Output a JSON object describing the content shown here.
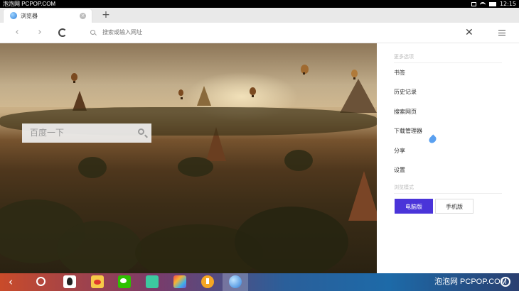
{
  "status_bar": {
    "watermark": "泡泡网 PCPOP.COM",
    "time": "12:15"
  },
  "tab": {
    "title": "浏览器",
    "close_glyph": "×",
    "new_tab_glyph": "+"
  },
  "toolbar": {
    "back_glyph": "‹",
    "forward_glyph": "›",
    "url_placeholder": "搜索或输入网址",
    "close_glyph": "✕"
  },
  "page": {
    "search_placeholder": "百度一下"
  },
  "menu": {
    "section_title": "更多选项",
    "items": [
      "书签",
      "历史记录",
      "搜索网页",
      "下载管理器",
      "分享",
      "设置"
    ],
    "mode_title": "浏览模式",
    "mode_desktop": "电脑版",
    "mode_mobile": "手机版",
    "selected_mode": "电脑版"
  },
  "taskbar": {
    "back_glyph": "‹",
    "watermark": "泡泡网  PCPOP.COM",
    "icons": [
      "back-icon",
      "home-icon",
      "qq-icon",
      "weibo-icon",
      "wechat-icon",
      "files-icon",
      "gallery-icon",
      "download-icon",
      "browser-icon"
    ]
  },
  "colors": {
    "accent": "#4a34d9",
    "tab_bar": "#e9e9e9"
  }
}
